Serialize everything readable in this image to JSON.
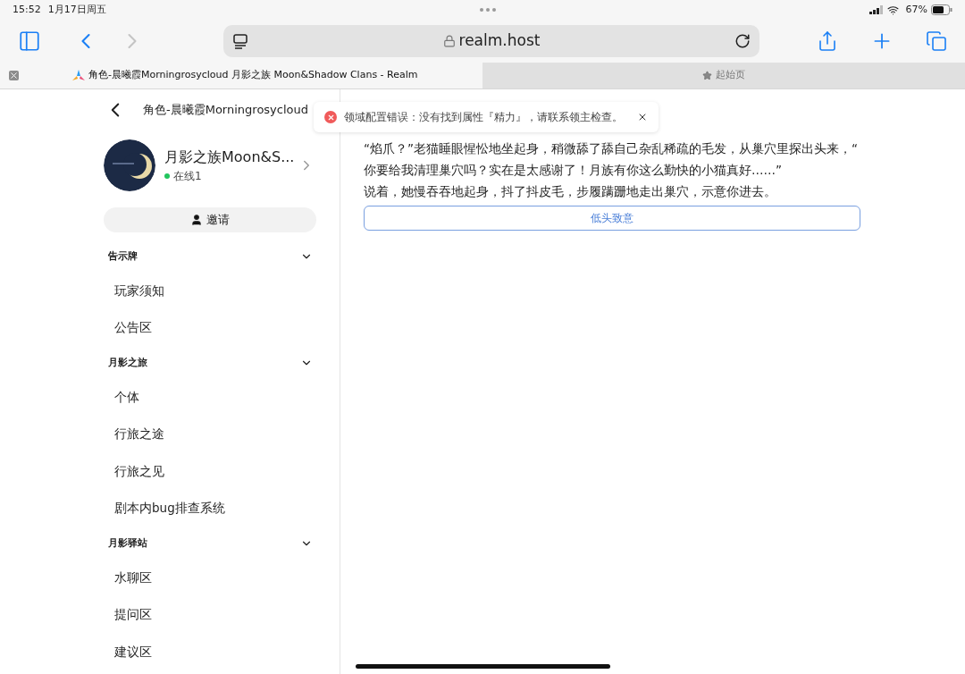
{
  "status_bar": {
    "time": "15:52",
    "date": "1月17日周五",
    "battery": "67%"
  },
  "browser": {
    "address": "realm.host",
    "tabs": [
      {
        "title": "角色-晨曦霞Morningrosycloud 月影之族 Moon&Shadow Clans - Realm",
        "selected": true
      },
      {
        "title": "起始页",
        "selected": false
      }
    ]
  },
  "sidebar": {
    "title": "角色-晨曦霞Morningrosycloud",
    "realm": {
      "name": "月影之族Moon&S...",
      "status": "在线1"
    },
    "invite": "邀请",
    "groups": [
      {
        "title": "告示牌",
        "expanded": true,
        "items": [
          "玩家须知",
          "公告区"
        ]
      },
      {
        "title": "月影之旅",
        "expanded": true,
        "items": [
          "个体",
          "行旅之途",
          "行旅之见",
          "剧本内bug排查系统"
        ]
      },
      {
        "title": "月影驿站",
        "expanded": true,
        "items": [
          "水聊区",
          "提问区",
          "建议区"
        ]
      }
    ]
  },
  "toast": {
    "message": "领域配置错误：没有找到属性『精力』，请联系领主检查。"
  },
  "story": {
    "lines": [
      "“焰爪？”老猫睡眼惺忪地坐起身，稍微舔了舔自己杂乱稀疏的毛发，从巢穴里探出头来，“",
      "你要给我清理巢穴吗？实在是太感谢了！月族有你这么勤快的小猫真好……”",
      "说着，她慢吞吞地起身，抖了抖皮毛，步履蹒跚地走出巢穴，示意你进去。"
    ],
    "choice": "低头致意"
  }
}
